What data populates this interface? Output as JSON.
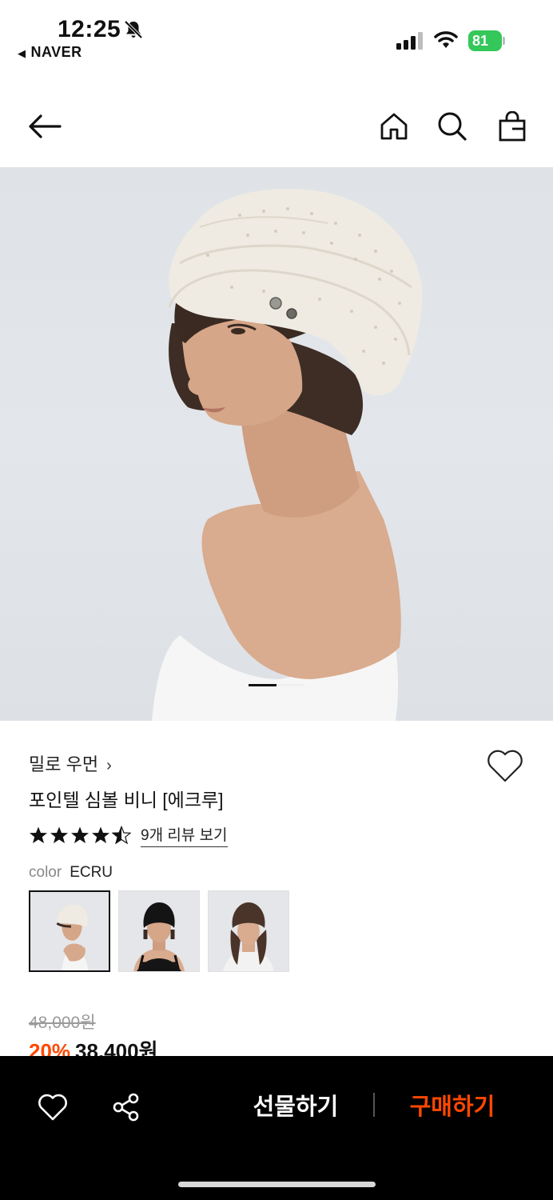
{
  "status_bar": {
    "time": "12:25",
    "back_app": "NAVER",
    "battery": "81",
    "icons": [
      "bell-slash-icon",
      "signal-icon",
      "wifi-icon",
      "battery-icon"
    ],
    "battery_color": "#34c759"
  },
  "nav": {
    "icons": [
      "back-arrow-icon",
      "home-icon",
      "search-icon",
      "shopping-bag-icon"
    ]
  },
  "product": {
    "brand": "밀로 우먼",
    "brand_chevron": "›",
    "title": "포인텔 심볼 비니 [에크루]",
    "rating": 4.5,
    "review_link": "9개 리뷰 보기",
    "color_label": "color",
    "color_value": "ECRU",
    "color_options": [
      {
        "name": "ECRU",
        "hat_color": "#efebe2",
        "selected": true
      },
      {
        "name": "BLACK",
        "hat_color": "#141414",
        "selected": false
      },
      {
        "name": "BROWN",
        "hat_color": "#4a3429",
        "selected": false
      }
    ],
    "image_carousel": {
      "current": 1,
      "total": 2
    },
    "original_price": "48,000원",
    "discount_rate": "20%",
    "sale_price": "38,400원",
    "accent_color": "#ff4800"
  },
  "bottom_bar": {
    "gift_label": "선물하기",
    "buy_label": "구매하기",
    "icons": [
      "heart-icon",
      "share-icon"
    ]
  }
}
